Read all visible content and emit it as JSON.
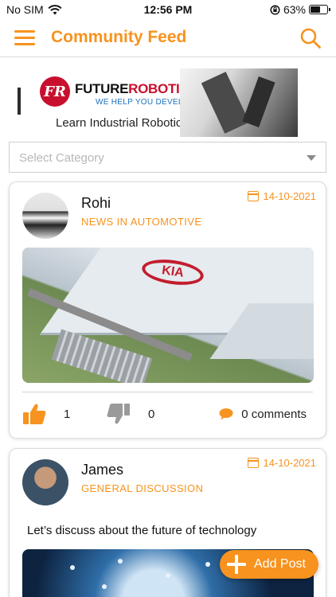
{
  "status_bar": {
    "carrier": "No SIM",
    "time": "12:56 PM",
    "battery_percent": "63%",
    "battery_level": 0.63
  },
  "header": {
    "title": "Community Feed",
    "menu_icon": "hamburger-menu-icon",
    "search_icon": "search-icon"
  },
  "banner": {
    "brand_first": "FUTURE",
    "brand_second": "ROBOTICS",
    "logo_letters": "FR",
    "tagline": "WE HELP YOU DEVELOP",
    "caption": "Learn Industrial Robotics"
  },
  "category_select": {
    "placeholder": "Select Category"
  },
  "posts": [
    {
      "author": "Rohi",
      "category": "NEWS IN AUTOMOTIVE",
      "date": "14-10-2021",
      "image_logo_text": "KIA",
      "likes": "1",
      "dislikes": "0",
      "comments": "0 comments"
    },
    {
      "author": "James",
      "category": "GENERAL DISCUSSION",
      "date": "14-10-2021",
      "text": "Let’s discuss about the future of technology"
    }
  ],
  "fab": {
    "label": "Add Post",
    "icon": "plus-icon"
  },
  "colors": {
    "accent": "#f7931e",
    "brand_red": "#c8102e",
    "tagline_blue": "#1a6fbf"
  }
}
